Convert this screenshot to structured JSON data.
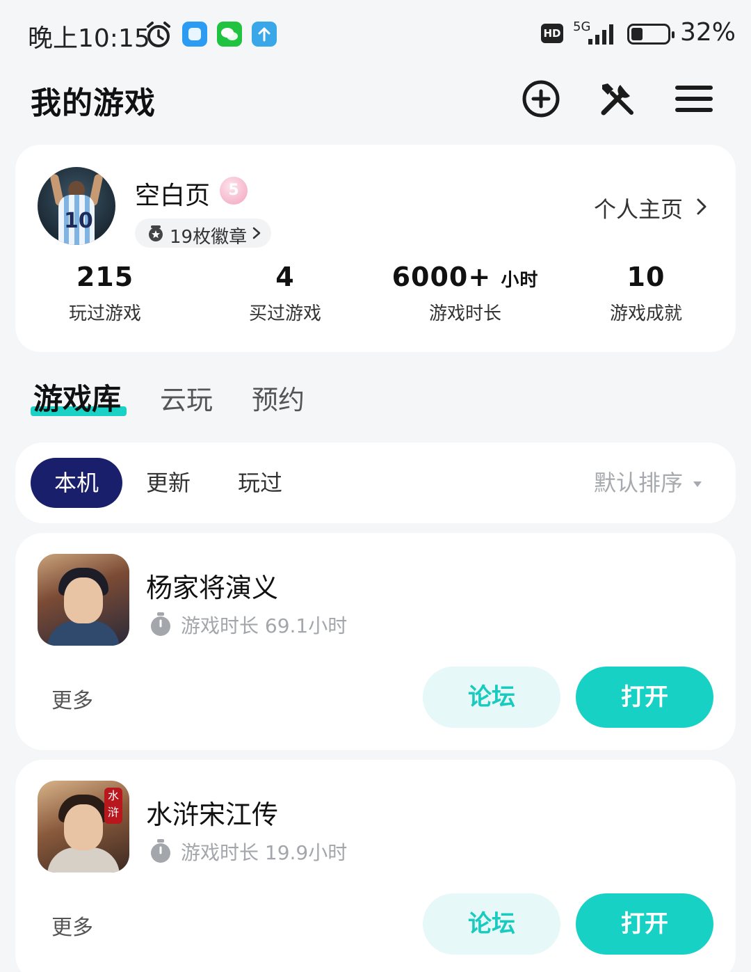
{
  "status_bar": {
    "time": "晚上10:15",
    "network_type": "5G",
    "hd_label": "HD",
    "battery_percent": "32%",
    "battery_level": 0.32,
    "notification_icons": [
      "alarm-icon",
      "qq-browser-icon",
      "wechat-icon",
      "upload-icon"
    ]
  },
  "header": {
    "title": "我的游戏",
    "icons": [
      "add-circle-icon",
      "tools-icon",
      "menu-icon"
    ]
  },
  "profile": {
    "username": "空白页",
    "vip_level": "5",
    "badges_label": "19枚徽章",
    "homepage_link": "个人主页",
    "stats": [
      {
        "value": "215",
        "unit": "",
        "label": "玩过游戏"
      },
      {
        "value": "4",
        "unit": "",
        "label": "买过游戏"
      },
      {
        "value": "6000+",
        "unit": "小时",
        "label": "游戏时长"
      },
      {
        "value": "10",
        "unit": "",
        "label": "游戏成就"
      }
    ]
  },
  "tabs": [
    {
      "label": "游戏库",
      "active": true
    },
    {
      "label": "云玩",
      "active": false
    },
    {
      "label": "预约",
      "active": false
    }
  ],
  "filters": {
    "chips": [
      {
        "label": "本机",
        "active": true
      },
      {
        "label": "更新",
        "active": false
      },
      {
        "label": "玩过",
        "active": false
      }
    ],
    "sort_label": "默认排序"
  },
  "games": [
    {
      "name": "杨家将演义",
      "playtime": "游戏时长 69.1小时",
      "more": "更多",
      "forum_button": "论坛",
      "open_button": "打开"
    },
    {
      "name": "水浒宋江传",
      "playtime": "游戏时长 19.9小时",
      "more": "更多",
      "forum_button": "论坛",
      "open_button": "打开",
      "icon_tag": "水浒"
    }
  ],
  "colors": {
    "accent": "#17d1c4",
    "accent_light": "#e6f8f7",
    "chip_active": "#1a1f6b",
    "background": "#f4f6f8"
  }
}
